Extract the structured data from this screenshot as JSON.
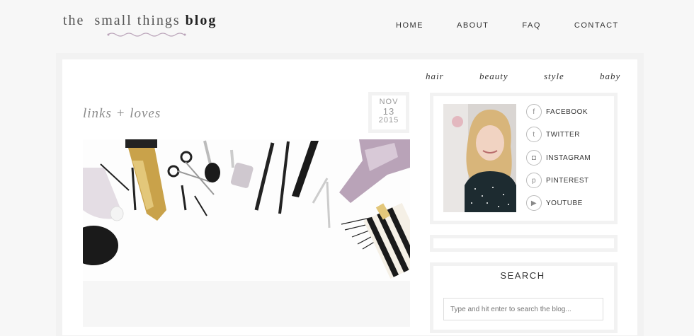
{
  "header": {
    "logo_part1": "the",
    "logo_part2": "small things",
    "logo_part3": "blog",
    "nav": [
      "HOME",
      "ABOUT",
      "FAQ",
      "CONTACT"
    ]
  },
  "categories": [
    "hair",
    "beauty",
    "style",
    "baby"
  ],
  "post": {
    "title": "links + loves",
    "date": {
      "month": "NOV",
      "day": "13",
      "year": "2015"
    }
  },
  "sidebar": {
    "social": [
      {
        "label": "FACEBOOK",
        "icon": "facebook-icon",
        "glyph": "f"
      },
      {
        "label": "TWITTER",
        "icon": "twitter-icon",
        "glyph": "t"
      },
      {
        "label": "INSTAGRAM",
        "icon": "instagram-icon",
        "glyph": "◘"
      },
      {
        "label": "PINTEREST",
        "icon": "pinterest-icon",
        "glyph": "p"
      },
      {
        "label": "YOUTUBE",
        "icon": "youtube-icon",
        "glyph": "▶"
      }
    ],
    "search": {
      "title": "SEARCH",
      "placeholder": "Type and hit enter to search the blog..."
    }
  },
  "colors": {
    "background": "#f7f7f7",
    "frame": "#f2f2f2",
    "accent": "#b9a3b8"
  }
}
